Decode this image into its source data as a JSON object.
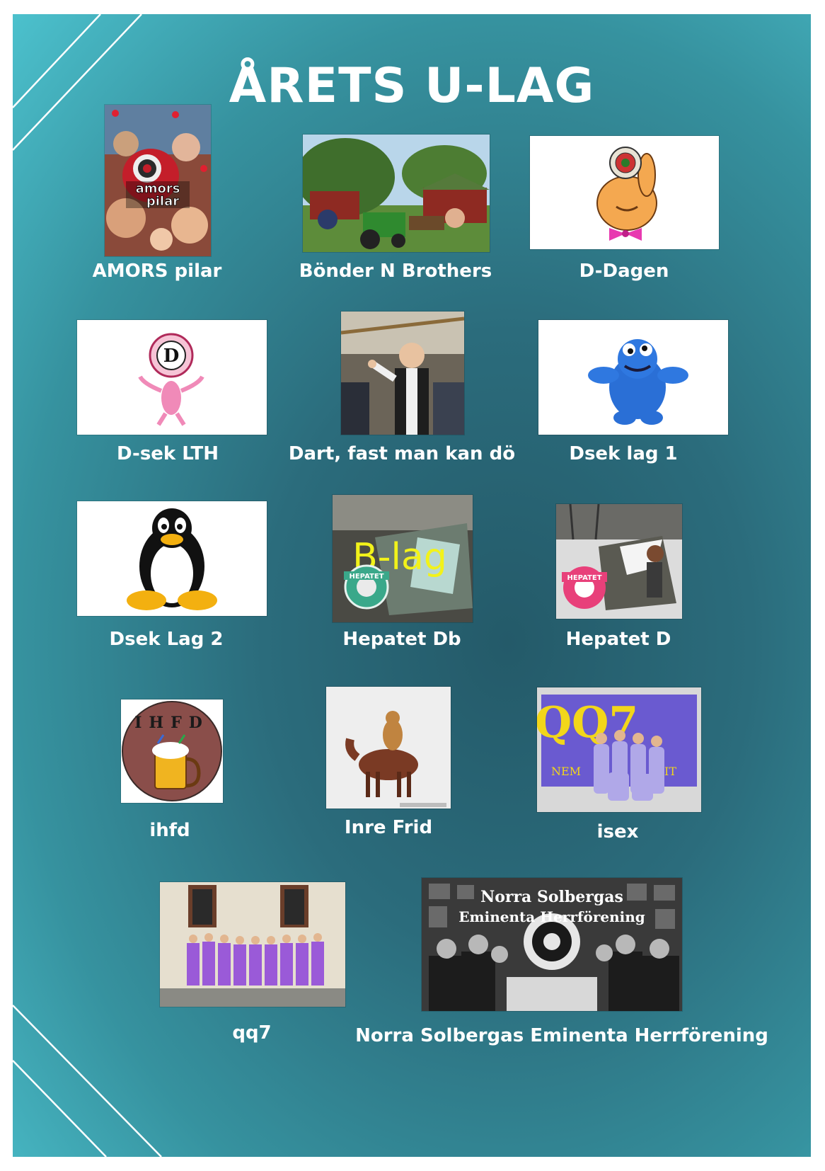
{
  "page": {
    "title": "ÅRETS U-LAG"
  },
  "teams": [
    {
      "name": "AMORS pilar",
      "image": "amors-pilar-collage",
      "image_text": "amors pilar"
    },
    {
      "name": "Bönder N Brothers",
      "image": "farm-tractor-photo"
    },
    {
      "name": "D-Dagen",
      "image": "bunny-dartboard-logo"
    },
    {
      "name": "D-sek LTH",
      "image": "dsek-pink-panther-logo",
      "image_text": "D"
    },
    {
      "name": "Dart, fast man kan dö",
      "image": "man-pointing-photo"
    },
    {
      "name": "Dsek lag 1",
      "image": "cookie-monster-plush"
    },
    {
      "name": "Dsek Lag 2",
      "image": "linux-penguin-logo"
    },
    {
      "name": "Hepatet Db",
      "image": "hepatet-b-lag-photo",
      "image_text": "B-lag"
    },
    {
      "name": "Hepatet D",
      "image": "hepatet-snow-photo",
      "image_text": "HEPATET"
    },
    {
      "name": "ihfd",
      "image": "beer-mug-logo",
      "image_text": "IHFD"
    },
    {
      "name": "Inre Frid",
      "image": "horse-rider-photo"
    },
    {
      "name": "isex",
      "image": "qq7-banner-group-photo",
      "image_text": "QQ7"
    },
    {
      "name": "qq7",
      "image": "purple-overalls-group-photo"
    },
    {
      "name": "Norra Solbergas Eminenta Herrförening",
      "image": "gentlemen-dartboard-photo",
      "image_text": [
        "Norra Solbergas",
        "Eminenta Herrförening"
      ]
    }
  ],
  "colors": {
    "background_inner": "#245a69",
    "background_outer": "#4cc1cd",
    "text": "#ffffff"
  }
}
